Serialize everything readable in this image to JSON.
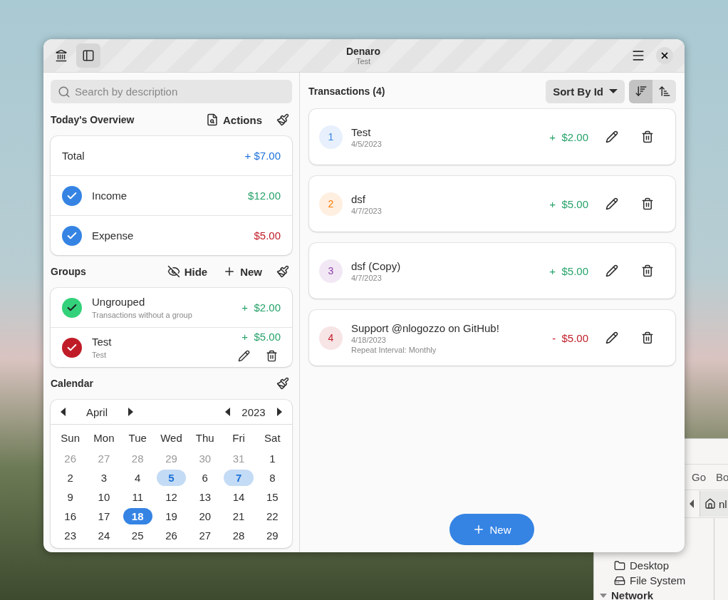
{
  "window": {
    "title": "Denaro",
    "subtitle": "Test"
  },
  "sidebar": {
    "search": {
      "placeholder": "Search by description"
    },
    "overview": {
      "title": "Today's Overview",
      "actions_label": "Actions",
      "rows": [
        {
          "kind": "total",
          "label": "Total",
          "amount": "+ $7.00"
        },
        {
          "kind": "income",
          "label": "Income",
          "amount": "$12.00",
          "checked": true
        },
        {
          "kind": "expense",
          "label": "Expense",
          "amount": "$5.00",
          "checked": true
        }
      ]
    },
    "groups": {
      "title": "Groups",
      "hide_label": "Hide",
      "new_label": "New",
      "items": [
        {
          "name": "Ungrouped",
          "description": "Transactions without a group",
          "amount": "+  $2.00",
          "color": "#33d17a",
          "checked": true,
          "editable": false
        },
        {
          "name": "Test",
          "description": "Test",
          "amount": "+  $5.00",
          "color": "#c01c28",
          "checked": true,
          "editable": true
        }
      ]
    },
    "calendar": {
      "title": "Calendar",
      "month": "April",
      "year": "2023",
      "weekdays": [
        "Sun",
        "Mon",
        "Tue",
        "Wed",
        "Thu",
        "Fri",
        "Sat"
      ],
      "weeks": [
        [
          {
            "day": "26",
            "outside": true,
            "marked": false,
            "selected": false
          },
          {
            "day": "27",
            "outside": true,
            "marked": false,
            "selected": false
          },
          {
            "day": "28",
            "outside": true,
            "marked": false,
            "selected": false
          },
          {
            "day": "29",
            "outside": true,
            "marked": false,
            "selected": false
          },
          {
            "day": "30",
            "outside": true,
            "marked": false,
            "selected": false
          },
          {
            "day": "31",
            "outside": true,
            "marked": false,
            "selected": false
          },
          {
            "day": "1",
            "outside": false,
            "marked": false,
            "selected": false
          }
        ],
        [
          {
            "day": "2",
            "outside": false,
            "marked": false,
            "selected": false
          },
          {
            "day": "3",
            "outside": false,
            "marked": false,
            "selected": false
          },
          {
            "day": "4",
            "outside": false,
            "marked": false,
            "selected": false
          },
          {
            "day": "5",
            "outside": false,
            "marked": true,
            "selected": false
          },
          {
            "day": "6",
            "outside": false,
            "marked": false,
            "selected": false
          },
          {
            "day": "7",
            "outside": false,
            "marked": true,
            "selected": false
          },
          {
            "day": "8",
            "outside": false,
            "marked": false,
            "selected": false
          }
        ],
        [
          {
            "day": "9",
            "outside": false,
            "marked": false,
            "selected": false
          },
          {
            "day": "10",
            "outside": false,
            "marked": false,
            "selected": false
          },
          {
            "day": "11",
            "outside": false,
            "marked": false,
            "selected": false
          },
          {
            "day": "12",
            "outside": false,
            "marked": false,
            "selected": false
          },
          {
            "day": "13",
            "outside": false,
            "marked": false,
            "selected": false
          },
          {
            "day": "14",
            "outside": false,
            "marked": false,
            "selected": false
          },
          {
            "day": "15",
            "outside": false,
            "marked": false,
            "selected": false
          }
        ],
        [
          {
            "day": "16",
            "outside": false,
            "marked": false,
            "selected": false
          },
          {
            "day": "17",
            "outside": false,
            "marked": false,
            "selected": false
          },
          {
            "day": "18",
            "outside": false,
            "marked": false,
            "selected": true
          },
          {
            "day": "19",
            "outside": false,
            "marked": false,
            "selected": false
          },
          {
            "day": "20",
            "outside": false,
            "marked": false,
            "selected": false
          },
          {
            "day": "21",
            "outside": false,
            "marked": false,
            "selected": false
          },
          {
            "day": "22",
            "outside": false,
            "marked": false,
            "selected": false
          }
        ],
        [
          {
            "day": "23",
            "outside": false,
            "marked": false,
            "selected": false
          },
          {
            "day": "24",
            "outside": false,
            "marked": false,
            "selected": false
          },
          {
            "day": "25",
            "outside": false,
            "marked": false,
            "selected": false
          },
          {
            "day": "26",
            "outside": false,
            "marked": false,
            "selected": false
          },
          {
            "day": "27",
            "outside": false,
            "marked": false,
            "selected": false
          },
          {
            "day": "28",
            "outside": false,
            "marked": false,
            "selected": false
          },
          {
            "day": "29",
            "outside": false,
            "marked": false,
            "selected": false
          }
        ]
      ]
    }
  },
  "transactions": {
    "title": "Transactions (4)",
    "sort_label": "Sort By Id",
    "sort_orders": [
      {
        "kind": "descending",
        "selected": true
      },
      {
        "kind": "ascending",
        "selected": false
      }
    ],
    "items": [
      {
        "id": "1",
        "description": "Test",
        "date": "4/5/2023",
        "amount": "+  $2.00",
        "kind": "income",
        "color": "#3584e4"
      },
      {
        "id": "2",
        "description": "dsf",
        "date": "4/7/2023",
        "amount": "+  $5.00",
        "kind": "income",
        "color": "#ff7800"
      },
      {
        "id": "3",
        "description": "dsf (Copy)",
        "date": "4/7/2023",
        "amount": "+  $5.00",
        "kind": "income",
        "color": "#9141ac"
      },
      {
        "id": "4",
        "description": "Support @nlogozzo on GitHub!",
        "date": "4/18/2023",
        "repeat": "Repeat Interval: Monthly",
        "amount": "-  $5.00",
        "kind": "expense",
        "color": "#c01c28"
      }
    ],
    "new_label": "New"
  },
  "background_window": {
    "menu": [
      "Go",
      "Bo"
    ],
    "path": "nl",
    "places": [
      "Desktop",
      "File System"
    ],
    "section": "Network"
  }
}
